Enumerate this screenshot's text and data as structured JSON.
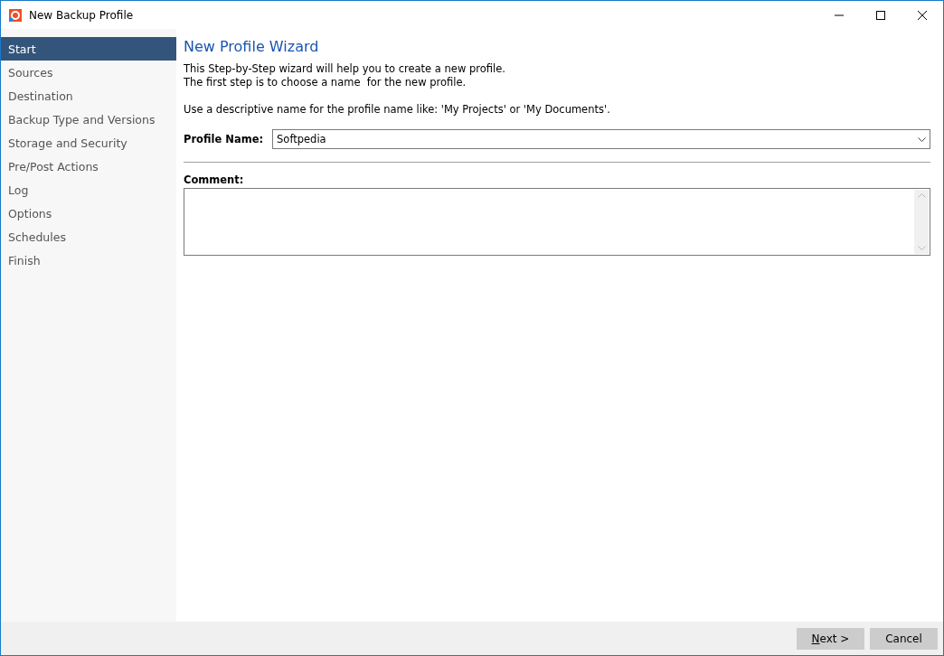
{
  "window": {
    "title": "New Backup Profile"
  },
  "sidebar": {
    "items": [
      {
        "label": "Start",
        "selected": true
      },
      {
        "label": "Sources",
        "selected": false
      },
      {
        "label": "Destination",
        "selected": false
      },
      {
        "label": "Backup Type and Versions",
        "selected": false
      },
      {
        "label": "Storage and Security",
        "selected": false
      },
      {
        "label": "Pre/Post Actions",
        "selected": false
      },
      {
        "label": "Log",
        "selected": false
      },
      {
        "label": "Options",
        "selected": false
      },
      {
        "label": "Schedules",
        "selected": false
      },
      {
        "label": "Finish",
        "selected": false
      }
    ]
  },
  "content": {
    "heading": "New Profile Wizard",
    "intro": [
      "This Step-by-Step wizard will help you to create a new profile.",
      "The first step is to choose a name  for the new profile."
    ],
    "hint": "Use a descriptive name for the profile name like: 'My Projects' or 'My Documents'.",
    "profile_name": {
      "label": "Profile Name:",
      "value": "Softpedia"
    },
    "comment": {
      "label": "Comment:"
    }
  },
  "buttons": [
    "Next >",
    "Cancel"
  ]
}
